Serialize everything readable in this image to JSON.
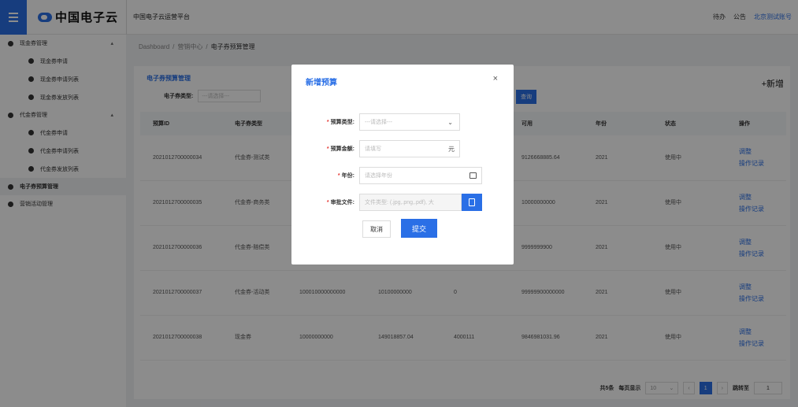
{
  "topbar": {
    "logo_text": "中国电子云",
    "platform": "中国电子云运营平台",
    "todo": "待办",
    "notice": "公告",
    "account": "北京测试账号"
  },
  "sidebar": {
    "items": [
      {
        "label": "现金券管理",
        "level": 1,
        "caret": "▴"
      },
      {
        "label": "现金券申请",
        "level": 2
      },
      {
        "label": "现金券申请列表",
        "level": 2
      },
      {
        "label": "现金券发放列表",
        "level": 2
      },
      {
        "label": "代金券管理",
        "level": 1,
        "caret": "▴"
      },
      {
        "label": "代金券申请",
        "level": 2
      },
      {
        "label": "代金券申请列表",
        "level": 2
      },
      {
        "label": "代金券发放列表",
        "level": 2
      },
      {
        "label": "电子券预算管理",
        "level": 1,
        "active": true
      },
      {
        "label": "营销活动管理",
        "level": 1
      }
    ]
  },
  "breadcrumb": [
    "Dashboard",
    "营销中心",
    "电子券预算管理"
  ],
  "panel": {
    "title": "电子券预算管理",
    "new_label": "+新增",
    "filter_label": "电子券类型:",
    "filter_placeholder": "---请选择---",
    "search_label": "查询"
  },
  "table": {
    "headers": [
      "预算ID",
      "电子券类型",
      "",
      "",
      "",
      "可用",
      "年份",
      "状态",
      "操作"
    ],
    "rows": [
      [
        "2021012700000034",
        "代金券-测试类",
        "",
        "",
        "",
        "9126668885.64",
        "2021",
        "使用中"
      ],
      [
        "2021012700000035",
        "代金券-商务类",
        "",
        "",
        "",
        "10000000000",
        "2021",
        "使用中"
      ],
      [
        "2021012700000036",
        "代金券-赔偿类",
        "",
        "",
        "",
        "9999999900",
        "2021",
        "使用中"
      ],
      [
        "2021012700000037",
        "代金券-活动类",
        "100010000000000",
        "10100000000",
        "0",
        "99999900000000",
        "2021",
        "使用中"
      ],
      [
        "2021012700000038",
        "现金券",
        "10000000000",
        "149018857.04",
        "4000111",
        "9846981031.96",
        "2021",
        "使用中"
      ]
    ],
    "op_adjust": "调整",
    "op_record": "操作记录"
  },
  "pager": {
    "total": "共5条",
    "per_page_label": "每页显示",
    "per_page": "10",
    "current_page": "1",
    "jump_label": "跳转至",
    "jump_value": "1"
  },
  "modal": {
    "title": "新增预算",
    "close": "×",
    "fields": {
      "type_label": "预算类型:",
      "type_placeholder": "---请选择---",
      "amount_label": "预算金额:",
      "amount_placeholder": "请填写",
      "amount_suffix": "元",
      "year_label": "年份:",
      "year_placeholder": "请选择年份",
      "file_label": "审批文件:",
      "file_placeholder": "文件类型: (.jpg,.png,.pdf), 大"
    },
    "cancel": "取消",
    "submit": "提交"
  },
  "colors": {
    "accent": "#2a6fe6",
    "required": "#e53935"
  }
}
